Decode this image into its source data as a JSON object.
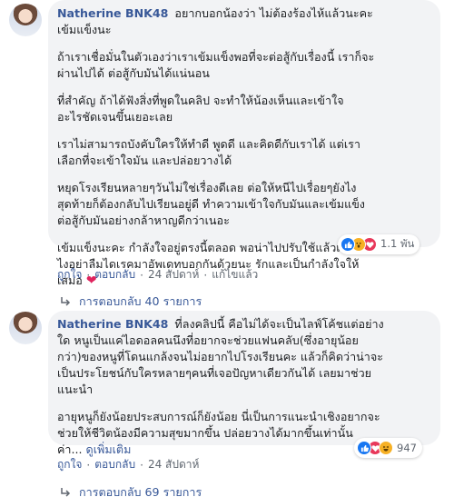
{
  "comments": [
    {
      "author": "Natherine BNK48",
      "paragraphs": [
        "อยากบอกน้องว่า ไม่ต้องร้องไห้แล้วนะคะ\nเข้มแข็งนะ",
        "ถ้าเราเชื่อมั่นในตัวเองว่าเราเข้มแข็งพอที่จะต่อสู้กับเรื่องนี้ เราก็จะ\nผ่านไปได้ ต่อสู้กับมันได้แน่นอน",
        "ที่สำคัญ ถ้าได้ฟังสิ่งที่พูดในคลิป จะทำให้น้องเห็นและเข้าใจ\nอะไรชัดเจนขึ้นเยอะเลย",
        "เราไม่สามารถบังคับใครให้ทำดี พูดดี และคิดดีกับเราได้ แต่เรา\nเลือกที่จะเข้าใจมัน และปล่อยวางได้",
        "หยุดโรงเรียนหลายๆวันไม่ใช่เรื่องดีเลย ต่อให้หนีไปเรื่อยๆยังไง\nสุดท้ายก็ต้องกลับไปเรียนอยู่ดี ทำความเข้าใจกับมันและเข้มแข็ง\nต่อสู้กับมันอย่างกล้าหาญดีกว่าเนอะ",
        "เข้มแข็งนะคะ กำลังใจอยู่ตรงนี้ตลอด พอน่าไปปรับใช้แล้วเป็นยัง\nไงอย่าลืมไดเรคมาอัพเดทบอกกันด้วยนะ รักและเป็นกำลังใจให้\nเสมอ"
      ],
      "heart": "❤",
      "reaction_count": "1.1 พัน",
      "actions": {
        "like": "ถูกใจ",
        "reply": "ตอบกลับ",
        "time": "24 สัปดาห์",
        "edited": "แก้ไขแล้ว"
      },
      "replies": "การตอบกลับ 40 รายการ"
    },
    {
      "author": "Natherine BNK48",
      "paragraphs": [
        "ที่ลงคลิปนี้ คือไม่ได้จะเป็นไลฟ์โค้ชแต่อย่าง\nใด หนูเป็นแค่ไอดอลคนนึงที่อยากจะช่วยแฟนคลับ(ซึ่งอายุน้อย\nกว่า)ของหนูที่โดนแกล้งจนไม่อยากไปโรงเรียนคะ แล้วก็คิดว่าน่าจะ\nเป็นประโยชน์กับใครหลายๆคนที่เจอปัญหาเดียวกันได้ เลยมาช่วย\nแนะนำ",
        "อายุหนูก็ยังน้อยประสบการณ์ก็ยังน้อย นี่เป็นการแนะนำเชิงอยากจะ\nช่วยให้ชีวิตน้องมีความสุขมากขึ้น ปล่อยวางได้มากขึ้นเท่านั้น\nค่า..."
      ],
      "see_more": "ดูเพิ่มเติม",
      "reaction_count": "947",
      "actions": {
        "like": "ถูกใจ",
        "reply": "ตอบกลับ",
        "time": "24 สัปดาห์"
      },
      "replies": "การตอบกลับ 69 รายการ"
    }
  ],
  "icons": {
    "like": "thumbs-up-icon",
    "love": "heart-icon",
    "wow": "wow-face-icon",
    "haha": "haha-face-icon",
    "reply_arrow": "reply-arrow-icon"
  },
  "colors": {
    "link": "#385898",
    "bubble": "#f2f3f5",
    "like": "#1877f2",
    "love": "#e8385a",
    "wow": "#f7b125"
  }
}
